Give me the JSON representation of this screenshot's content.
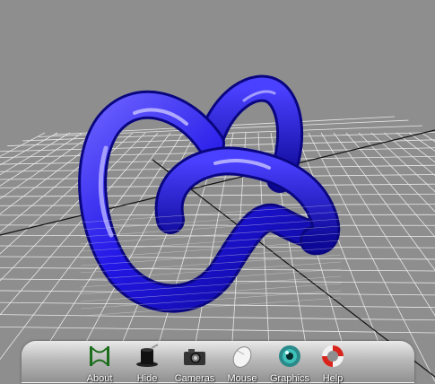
{
  "scene": {
    "background_color": "#8e8e8e",
    "grid_color": "#e8e8e8",
    "axis_color": "#111111",
    "object_color": "#1a12d6",
    "object": "knot-tube",
    "grid": true
  },
  "toolbar": {
    "items": [
      {
        "label": "About",
        "icon": "about-icon"
      },
      {
        "label": "Hide",
        "icon": "magic-hat-icon"
      },
      {
        "label": "Cameras",
        "icon": "camera-icon"
      },
      {
        "label": "Mouse",
        "icon": "mouse-icon"
      },
      {
        "label": "Graphics",
        "icon": "eye-icon"
      },
      {
        "label": "Help",
        "icon": "lifebuoy-icon"
      }
    ]
  }
}
